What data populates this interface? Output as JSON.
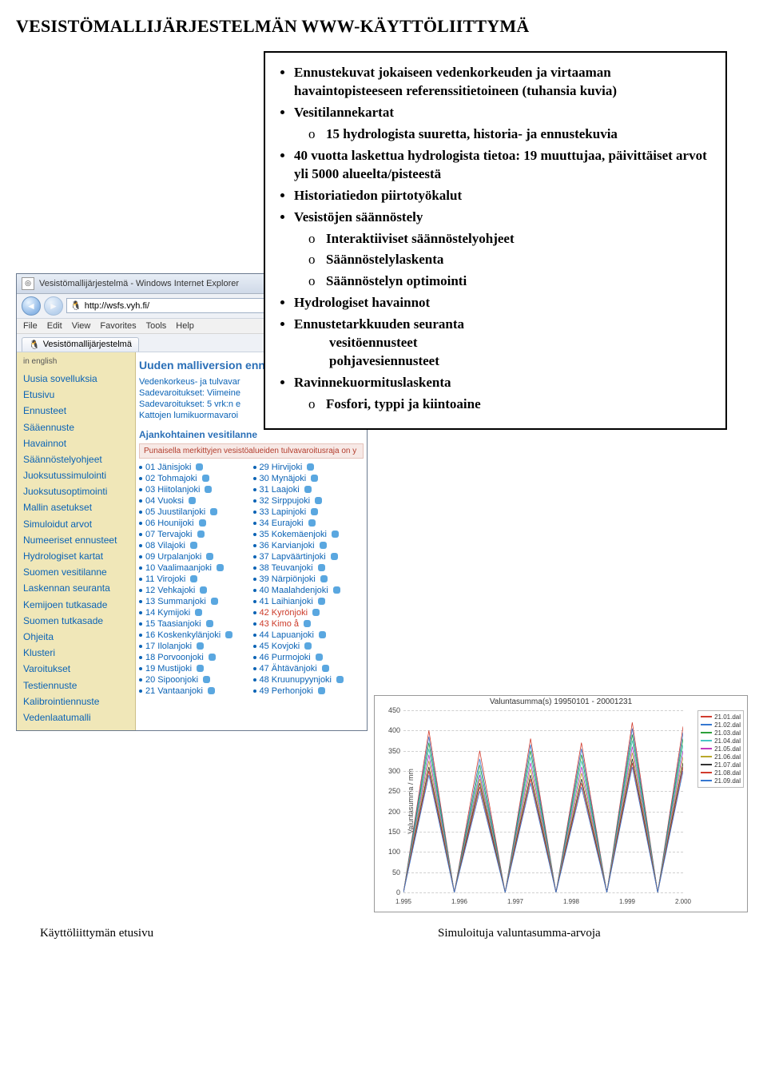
{
  "title": "VESISTÖMALLIJÄRJESTELMÄN WWW-KÄYTTÖLIITTYMÄ",
  "info": {
    "items": [
      "Ennustekuvat jokaiseen vedenkorkeuden ja virtaaman havaintopisteeseen referenssitietoineen (tuhansia kuvia)",
      "Vesitilannekartat"
    ],
    "sub1": [
      "15 hydrologista suuretta, historia- ja ennustekuvia"
    ],
    "item2": "40 vuotta laskettua hydrologista tietoa: 19 muuttujaa, päivittäiset arvot yli 5000 alueelta/pisteestä",
    "item3": "Historiatiedon piirtotyökalut",
    "item4": "Vesistöjen säännöstely",
    "sub4": [
      "Interaktiiviset säännöstelyohjeet",
      "Säännöstelylaskenta",
      "Säännöstelyn optimointi"
    ],
    "item5": "Hydrologiset havainnot",
    "item6": "Ennustetarkkuuden seuranta",
    "item6a": "vesitöennusteet",
    "item6b": "pohjavesiennusteet",
    "item7": "Ravinnekuormituslaskenta",
    "sub7": [
      "Fosfori, typpi ja kiintoaine"
    ]
  },
  "browser": {
    "window_title": "Vesistömallijärjestelmä - Windows Internet Explorer",
    "url": "http://wsfs.vyh.fi/",
    "menus": [
      "File",
      "Edit",
      "View",
      "Favorites",
      "Tools",
      "Help"
    ],
    "tab_label": "Vesistömallijärjestelmä",
    "sidebar_lang": "in english",
    "sidebar": [
      "Uusia sovelluksia",
      "Etusivu",
      "Ennusteet",
      "Sääennuste",
      "Havainnot",
      "Säännöstelyohjeet",
      "Juoksutussimulointi",
      "Juoksutusoptimointi",
      "Mallin asetukset",
      "Simuloidut arvot",
      "Numeeriset ennusteet",
      "Hydrologiset kartat",
      "Suomen vesitilanne",
      "Laskennan seuranta",
      "Kemijoen tutkasade",
      "Suomen tutkasade",
      "Ohjeita",
      "Klusteri",
      "Varoitukset",
      "Testiennuste",
      "Kalibrointiennuste",
      "Vedenlaatumalli"
    ],
    "main_heading": "Uuden malliversion enn",
    "main_links": [
      "Vedenkorkeus- ja tulvavar",
      "Sadevaroitukset: Viimeine",
      "Sadevaroitukset: 5 vrk:n e",
      "Kattojen lumikuormavaroi"
    ],
    "sub_heading": "Ajankohtainen vesitilanne",
    "flood_note": "Punaisella merkittyjen vesistöalueiden tulvavaroitusraja on y",
    "rivers_left": [
      "01 Jänisjoki",
      "02 Tohmajoki",
      "03 Hiitolanjoki",
      "04 Vuoksi",
      "05 Juustilanjoki",
      "06 Hounijoki",
      "07 Tervajoki",
      "08 Vilajoki",
      "09 Urpalanjoki",
      "10 Vaalimaanjoki",
      "11 Virojoki",
      "12 Vehkajoki",
      "13 Summanjoki",
      "14 Kymijoki",
      "15 Taasianjoki",
      "16 Koskenkylänjoki",
      "17 Ilolanjoki",
      "18 Porvoonjoki",
      "19 Mustijoki",
      "20 Sipoonjoki",
      "21 Vantaanjoki"
    ],
    "rivers_right": [
      "29 Hirvijoki",
      "30 Mynäjoki",
      "31 Laajoki",
      "32 Sirppujoki",
      "33 Lapinjoki",
      "34 Eurajoki",
      "35 Kokemäenjoki",
      "36 Karvianjoki",
      "37 Lapväärtinjoki",
      "38 Teuvanjoki",
      "39 Närpiönjoki",
      "40 Maalahdenjoki",
      "41 Laihianjoki",
      "42 Kyrönjoki",
      "43 Kimo å",
      "44 Lapuanjoki",
      "45 Kovjoki",
      "46 Purmojoki",
      "47 Ähtävänjoki",
      "48 Kruunupyynjoki",
      "49 Perhonjoki"
    ],
    "rivers_right_red": [
      42,
      43
    ]
  },
  "chart_data": {
    "type": "line",
    "title": "Valuntasumma(s)  19950101 - 20001231",
    "ylabel": "Valuntasumma / mm",
    "ylim": [
      0,
      450
    ],
    "yticks": [
      0,
      50,
      100,
      150,
      200,
      250,
      300,
      350,
      400,
      450
    ],
    "x_categories": [
      "1.995",
      "1.996",
      "1.997",
      "1.998",
      "1.999",
      "2.000"
    ],
    "legend_colors": {
      "21.01.dal": "#d13c2e",
      "21.02.dal": "#3678d1",
      "21.03.dal": "#2da03a",
      "21.04.dal": "#46c5c5",
      "21.05.dal": "#c13bbd",
      "21.06.dal": "#b9a82b",
      "21.07.dal": "#323232",
      "21.08.dal": "#d13c2e",
      "21.09.dal": "#3678d1"
    },
    "series": [
      {
        "name": "21.01.dal",
        "values": [
          0,
          400,
          0,
          350,
          0,
          380,
          0,
          370,
          0,
          420,
          0,
          410
        ]
      },
      {
        "name": "21.02.dal",
        "values": [
          0,
          385,
          0,
          330,
          0,
          365,
          0,
          355,
          0,
          405,
          0,
          395
        ]
      },
      {
        "name": "21.03.dal",
        "values": [
          0,
          370,
          0,
          315,
          0,
          350,
          0,
          340,
          0,
          390,
          0,
          380
        ]
      },
      {
        "name": "21.04.dal",
        "values": [
          0,
          355,
          0,
          300,
          0,
          335,
          0,
          325,
          0,
          375,
          0,
          365
        ]
      },
      {
        "name": "21.05.dal",
        "values": [
          0,
          340,
          0,
          290,
          0,
          320,
          0,
          310,
          0,
          360,
          0,
          350
        ]
      },
      {
        "name": "21.06.dal",
        "values": [
          0,
          325,
          0,
          280,
          0,
          305,
          0,
          295,
          0,
          345,
          0,
          335
        ]
      },
      {
        "name": "21.07.dal",
        "values": [
          0,
          310,
          0,
          270,
          0,
          290,
          0,
          280,
          0,
          330,
          0,
          320
        ]
      },
      {
        "name": "21.08.dal",
        "values": [
          0,
          300,
          0,
          260,
          0,
          280,
          0,
          270,
          0,
          320,
          0,
          310
        ]
      },
      {
        "name": "21.09.dal",
        "values": [
          0,
          290,
          0,
          250,
          0,
          270,
          0,
          260,
          0,
          310,
          0,
          300
        ]
      }
    ]
  },
  "captions": {
    "left": "Käyttöliittymän etusivu",
    "right": "Simuloituja valuntasumma-arvoja"
  }
}
